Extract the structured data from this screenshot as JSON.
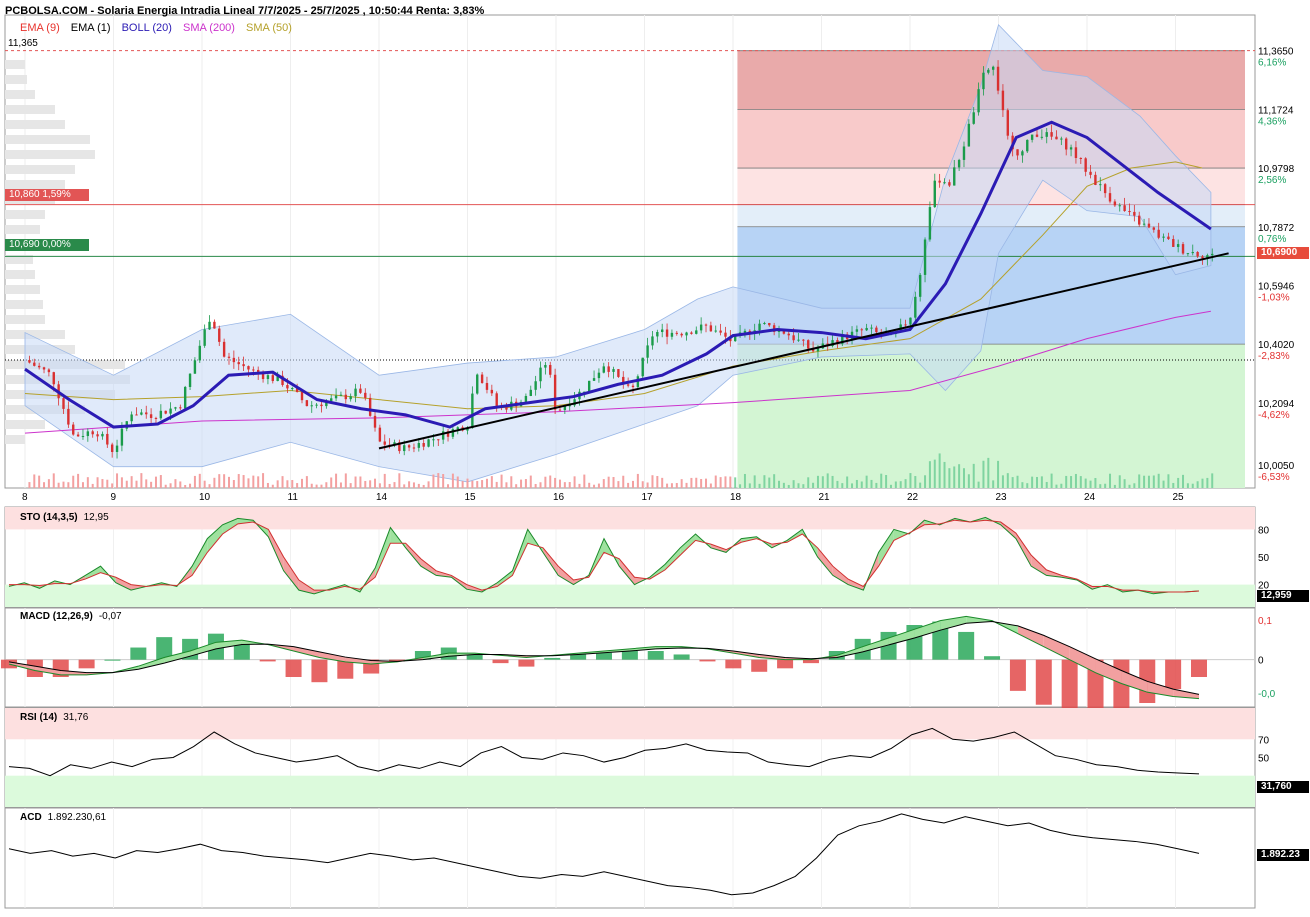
{
  "header": {
    "title": "PCBOLSA.COM - Solaria Energia Intradia Lineal 7/7/2025 - 25/7/2025 , 10:50:44 Renta: 3,83%"
  },
  "legend": [
    {
      "label": "EMA (9)",
      "color": "#e8322c"
    },
    {
      "label": "EMA (1)",
      "color": "#000000"
    },
    {
      "label": "BOLL (20)",
      "color": "#2b1bb4"
    },
    {
      "label": "SMA (200)",
      "color": "#cc33cc"
    },
    {
      "label": "SMA (50)",
      "color": "#b5a12b"
    }
  ],
  "price_panel": {
    "top_value_label": "11,365",
    "tags": [
      {
        "text": "10,860  1,59%",
        "color": "#e25555"
      },
      {
        "text": "10,690  0,00%",
        "color": "#2a8a4a"
      }
    ],
    "last_price_tag": "10,6900"
  },
  "panels": {
    "sto": {
      "title": "STO (14,3,5)",
      "value": "12,95",
      "last_tag": "12,959"
    },
    "macd": {
      "title": "MACD (12,26,9)",
      "value": "-0,07"
    },
    "rsi": {
      "title": "RSI (14)",
      "value": "31,76",
      "last_tag": "31,760"
    },
    "acd": {
      "title": "ACD",
      "value": "1.892.230,61",
      "last_tag": "1.892.23"
    }
  },
  "chart_data": [
    {
      "type": "candlestick",
      "title": "Solaria Energia Intradia Lineal 7/7/2025 - 25/7/2025",
      "x_tick_labels": [
        "8",
        "9",
        "10",
        "11",
        "14",
        "15",
        "16",
        "17",
        "18",
        "21",
        "22",
        "23",
        "24",
        "25"
      ],
      "y_tick_labels": [
        "11,3650",
        "11,1724",
        "10,9798",
        "10,7872",
        "10,5946",
        "10,4020",
        "10,2094",
        "10,0050"
      ],
      "pct_tick_labels": [
        "6,16%",
        "4,36%",
        "2,56%",
        "0,76%",
        "-1,03%",
        "-2,83%",
        "-4,62%",
        "-6,53%"
      ],
      "ylim": [
        9.93,
        11.4
      ],
      "close_series": [
        {
          "x": 0,
          "y": 10.35
        },
        {
          "x": 0.3,
          "y": 10.3
        },
        {
          "x": 0.55,
          "y": 10.1
        },
        {
          "x": 0.8,
          "y": 10.12
        },
        {
          "x": 1.0,
          "y": 10.05
        },
        {
          "x": 1.2,
          "y": 10.18
        },
        {
          "x": 1.45,
          "y": 10.17
        },
        {
          "x": 1.75,
          "y": 10.2
        },
        {
          "x": 2.0,
          "y": 10.42
        },
        {
          "x": 2.1,
          "y": 10.5
        },
        {
          "x": 2.25,
          "y": 10.36
        },
        {
          "x": 2.6,
          "y": 10.31
        },
        {
          "x": 2.9,
          "y": 10.28
        },
        {
          "x": 3.2,
          "y": 10.2
        },
        {
          "x": 3.5,
          "y": 10.22
        },
        {
          "x": 3.8,
          "y": 10.25
        },
        {
          "x": 4.0,
          "y": 10.08
        },
        {
          "x": 4.3,
          "y": 10.06
        },
        {
          "x": 4.6,
          "y": 10.09
        },
        {
          "x": 5.0,
          "y": 10.14
        },
        {
          "x": 5.1,
          "y": 10.32
        },
        {
          "x": 5.35,
          "y": 10.19
        },
        {
          "x": 5.65,
          "y": 10.22
        },
        {
          "x": 5.9,
          "y": 10.35
        },
        {
          "x": 6.0,
          "y": 10.18
        },
        {
          "x": 6.3,
          "y": 10.25
        },
        {
          "x": 6.55,
          "y": 10.34
        },
        {
          "x": 6.85,
          "y": 10.24
        },
        {
          "x": 7.1,
          "y": 10.44
        },
        {
          "x": 7.4,
          "y": 10.44
        },
        {
          "x": 7.7,
          "y": 10.46
        },
        {
          "x": 8.0,
          "y": 10.41
        },
        {
          "x": 8.3,
          "y": 10.47
        },
        {
          "x": 8.6,
          "y": 10.44
        },
        {
          "x": 8.9,
          "y": 10.38
        },
        {
          "x": 9.2,
          "y": 10.42
        },
        {
          "x": 9.5,
          "y": 10.45
        },
        {
          "x": 9.8,
          "y": 10.42
        },
        {
          "x": 10.0,
          "y": 10.49
        },
        {
          "x": 10.1,
          "y": 10.6
        },
        {
          "x": 10.2,
          "y": 10.82
        },
        {
          "x": 10.3,
          "y": 10.95
        },
        {
          "x": 10.45,
          "y": 10.93
        },
        {
          "x": 10.6,
          "y": 11.05
        },
        {
          "x": 10.75,
          "y": 11.2
        },
        {
          "x": 10.85,
          "y": 11.3
        },
        {
          "x": 10.95,
          "y": 11.31
        },
        {
          "x": 11.1,
          "y": 11.08
        },
        {
          "x": 11.25,
          "y": 11.02
        },
        {
          "x": 11.4,
          "y": 11.1
        },
        {
          "x": 11.6,
          "y": 11.08
        },
        {
          "x": 11.8,
          "y": 11.05
        },
        {
          "x": 12.0,
          "y": 10.97
        },
        {
          "x": 12.2,
          "y": 10.9
        },
        {
          "x": 12.45,
          "y": 10.83
        },
        {
          "x": 12.7,
          "y": 10.78
        },
        {
          "x": 12.9,
          "y": 10.74
        },
        {
          "x": 13.1,
          "y": 10.71
        },
        {
          "x": 13.25,
          "y": 10.7
        },
        {
          "x": 13.42,
          "y": 10.69
        }
      ],
      "boll_mid": [
        {
          "x": 0,
          "y": 10.32
        },
        {
          "x": 0.5,
          "y": 10.22
        },
        {
          "x": 1.0,
          "y": 10.13
        },
        {
          "x": 1.5,
          "y": 10.14
        },
        {
          "x": 1.9,
          "y": 10.2
        },
        {
          "x": 2.3,
          "y": 10.3
        },
        {
          "x": 2.8,
          "y": 10.31
        },
        {
          "x": 3.3,
          "y": 10.22
        },
        {
          "x": 3.8,
          "y": 10.19
        },
        {
          "x": 4.3,
          "y": 10.17
        },
        {
          "x": 4.8,
          "y": 10.13
        },
        {
          "x": 5.2,
          "y": 10.19
        },
        {
          "x": 5.7,
          "y": 10.21
        },
        {
          "x": 6.2,
          "y": 10.23
        },
        {
          "x": 6.7,
          "y": 10.27
        },
        {
          "x": 7.2,
          "y": 10.3
        },
        {
          "x": 7.7,
          "y": 10.37
        },
        {
          "x": 8.0,
          "y": 10.43
        },
        {
          "x": 8.5,
          "y": 10.45
        },
        {
          "x": 9.0,
          "y": 10.44
        },
        {
          "x": 9.5,
          "y": 10.42
        },
        {
          "x": 10.0,
          "y": 10.45
        },
        {
          "x": 10.4,
          "y": 10.6
        },
        {
          "x": 10.8,
          "y": 10.83
        },
        {
          "x": 11.2,
          "y": 11.08
        },
        {
          "x": 11.6,
          "y": 11.13
        },
        {
          "x": 12.0,
          "y": 11.08
        },
        {
          "x": 12.4,
          "y": 10.99
        },
        {
          "x": 12.8,
          "y": 10.9
        },
        {
          "x": 13.2,
          "y": 10.82
        },
        {
          "x": 13.4,
          "y": 10.78
        }
      ],
      "sma50": [
        {
          "x": 0,
          "y": 10.24
        },
        {
          "x": 1.0,
          "y": 10.22
        },
        {
          "x": 2.0,
          "y": 10.23
        },
        {
          "x": 3.0,
          "y": 10.25
        },
        {
          "x": 4.0,
          "y": 10.22
        },
        {
          "x": 5.0,
          "y": 10.19
        },
        {
          "x": 6.0,
          "y": 10.2
        },
        {
          "x": 7.0,
          "y": 10.24
        },
        {
          "x": 8.0,
          "y": 10.33
        },
        {
          "x": 9.0,
          "y": 10.38
        },
        {
          "x": 10.0,
          "y": 10.42
        },
        {
          "x": 10.8,
          "y": 10.55
        },
        {
          "x": 11.5,
          "y": 10.76
        },
        {
          "x": 12.0,
          "y": 10.92
        },
        {
          "x": 12.5,
          "y": 10.98
        },
        {
          "x": 13.0,
          "y": 11.0
        },
        {
          "x": 13.3,
          "y": 10.98
        }
      ],
      "sma200": [
        {
          "x": 0,
          "y": 10.11
        },
        {
          "x": 2.0,
          "y": 10.15
        },
        {
          "x": 4.0,
          "y": 10.16
        },
        {
          "x": 6.0,
          "y": 10.18
        },
        {
          "x": 8.0,
          "y": 10.21
        },
        {
          "x": 10.0,
          "y": 10.25
        },
        {
          "x": 11.0,
          "y": 10.33
        },
        {
          "x": 12.0,
          "y": 10.42
        },
        {
          "x": 13.0,
          "y": 10.49
        },
        {
          "x": 13.4,
          "y": 10.51
        }
      ],
      "boll_upper": [
        {
          "x": 0,
          "y": 10.44
        },
        {
          "x": 1.0,
          "y": 10.3
        },
        {
          "x": 2.0,
          "y": 10.45
        },
        {
          "x": 3.0,
          "y": 10.5
        },
        {
          "x": 4.0,
          "y": 10.3
        },
        {
          "x": 5.0,
          "y": 10.34
        },
        {
          "x": 6.0,
          "y": 10.36
        },
        {
          "x": 7.0,
          "y": 10.45
        },
        {
          "x": 7.6,
          "y": 10.55
        },
        {
          "x": 8.0,
          "y": 10.59
        },
        {
          "x": 9.0,
          "y": 10.52
        },
        {
          "x": 10.0,
          "y": 10.52
        },
        {
          "x": 10.4,
          "y": 10.95
        },
        {
          "x": 10.8,
          "y": 11.25
        },
        {
          "x": 11.0,
          "y": 11.45
        },
        {
          "x": 11.5,
          "y": 11.3
        },
        {
          "x": 12.0,
          "y": 11.28
        },
        {
          "x": 12.6,
          "y": 11.15
        },
        {
          "x": 13.0,
          "y": 11.02
        },
        {
          "x": 13.4,
          "y": 10.9
        }
      ],
      "boll_lower": [
        {
          "x": 0,
          "y": 10.2
        },
        {
          "x": 1.0,
          "y": 10.0
        },
        {
          "x": 2.0,
          "y": 10.0
        },
        {
          "x": 3.0,
          "y": 10.08
        },
        {
          "x": 4.0,
          "y": 10.0
        },
        {
          "x": 5.0,
          "y": 9.95
        },
        {
          "x": 6.0,
          "y": 10.04
        },
        {
          "x": 7.0,
          "y": 10.14
        },
        {
          "x": 7.6,
          "y": 10.2
        },
        {
          "x": 8.0,
          "y": 10.3
        },
        {
          "x": 9.0,
          "y": 10.36
        },
        {
          "x": 10.0,
          "y": 10.37
        },
        {
          "x": 10.4,
          "y": 10.25
        },
        {
          "x": 10.8,
          "y": 10.38
        },
        {
          "x": 11.0,
          "y": 10.7
        },
        {
          "x": 11.5,
          "y": 10.94
        },
        {
          "x": 12.0,
          "y": 10.84
        },
        {
          "x": 12.6,
          "y": 10.82
        },
        {
          "x": 13.0,
          "y": 10.63
        },
        {
          "x": 13.4,
          "y": 10.66
        }
      ],
      "trendline": [
        {
          "x": 4.0,
          "y": 10.06
        },
        {
          "x": 13.6,
          "y": 10.7
        }
      ],
      "fib_levels": [
        11.365,
        11.1724,
        10.9798,
        10.86,
        10.7872,
        10.69,
        10.402
      ],
      "reference_lines": [
        {
          "name": "max",
          "y": 11.365
        },
        {
          "name": "stop",
          "y": 10.86
        },
        {
          "name": "base",
          "y": 10.69
        }
      ]
    },
    {
      "type": "line",
      "title": "STO (14,3,5)",
      "y_tick_labels": [
        "80",
        "50",
        "20"
      ],
      "ylim": [
        0,
        100
      ],
      "zones": [
        20,
        80
      ],
      "series": [
        {
          "name": "%K",
          "values": [
            18,
            22,
            16,
            24,
            20,
            30,
            40,
            22,
            14,
            18,
            22,
            18,
            40,
            70,
            85,
            92,
            90,
            72,
            35,
            14,
            10,
            15,
            20,
            12,
            38,
            82,
            60,
            40,
            30,
            28,
            15,
            12,
            22,
            35,
            80,
            55,
            30,
            20,
            30,
            70,
            40,
            20,
            28,
            42,
            60,
            75,
            60,
            55,
            70,
            72,
            60,
            68,
            80,
            50,
            30,
            20,
            14,
            55,
            80,
            75,
            90,
            85,
            92,
            88,
            93,
            85,
            70,
            40,
            30,
            28,
            25,
            15,
            20,
            12,
            14,
            10,
            12,
            12,
            13
          ]
        },
        {
          "name": "%D",
          "values": [
            20,
            20,
            19,
            21,
            21,
            26,
            33,
            28,
            20,
            18,
            20,
            19,
            30,
            55,
            75,
            86,
            88,
            80,
            50,
            25,
            14,
            14,
            18,
            15,
            28,
            65,
            65,
            48,
            35,
            30,
            20,
            14,
            18,
            30,
            65,
            60,
            40,
            25,
            28,
            55,
            48,
            28,
            26,
            36,
            52,
            68,
            64,
            58,
            66,
            70,
            64,
            66,
            75,
            60,
            40,
            26,
            18,
            40,
            68,
            76,
            85,
            86,
            90,
            88,
            90,
            88,
            76,
            52,
            36,
            30,
            26,
            18,
            18,
            14,
            14,
            12,
            12,
            12,
            13
          ]
        }
      ]
    },
    {
      "type": "line",
      "title": "MACD (12,26,9)",
      "y_tick_labels": [
        "0,1",
        "0",
        "-0,0"
      ],
      "ylim": [
        -0.1,
        0.11
      ],
      "series": [
        {
          "name": "MACD",
          "values": [
            -0.01,
            -0.025,
            -0.035,
            -0.035,
            -0.03,
            -0.015,
            0.005,
            0.02,
            0.04,
            0.045,
            0.035,
            0.02,
            0.005,
            -0.005,
            -0.01,
            -0.005,
            0.005,
            0.015,
            0.015,
            0.01,
            0.005,
            0.01,
            0.015,
            0.02,
            0.025,
            0.03,
            0.03,
            0.025,
            0.015,
            0.005,
            0.0,
            0.0,
            0.01,
            0.03,
            0.05,
            0.07,
            0.09,
            0.1,
            0.09,
            0.06,
            0.03,
            0.0,
            -0.03,
            -0.055,
            -0.075,
            -0.085,
            -0.09
          ]
        },
        {
          "name": "Signal",
          "values": [
            -0.005,
            -0.015,
            -0.025,
            -0.03,
            -0.03,
            -0.022,
            -0.008,
            0.008,
            0.025,
            0.035,
            0.036,
            0.03,
            0.018,
            0.006,
            -0.002,
            -0.004,
            0.0,
            0.008,
            0.012,
            0.012,
            0.009,
            0.009,
            0.012,
            0.016,
            0.02,
            0.025,
            0.027,
            0.026,
            0.02,
            0.012,
            0.005,
            0.002,
            0.005,
            0.018,
            0.034,
            0.05,
            0.068,
            0.084,
            0.088,
            0.078,
            0.056,
            0.03,
            0.002,
            -0.025,
            -0.05,
            -0.068,
            -0.08
          ]
        }
      ]
    },
    {
      "type": "line",
      "title": "RSI (14)",
      "y_tick_labels": [
        "70",
        "50"
      ],
      "ylim": [
        0,
        100
      ],
      "zones": [
        30,
        70
      ],
      "series": [
        {
          "name": "RSI",
          "values": [
            40,
            38,
            30,
            42,
            38,
            45,
            40,
            48,
            50,
            62,
            78,
            65,
            55,
            50,
            45,
            48,
            52,
            40,
            35,
            42,
            38,
            45,
            40,
            55,
            62,
            50,
            48,
            55,
            52,
            45,
            50,
            58,
            60,
            65,
            58,
            56,
            55,
            45,
            42,
            40,
            48,
            52,
            50,
            60,
            75,
            82,
            70,
            68,
            72,
            78,
            65,
            52,
            48,
            42,
            40,
            36,
            34,
            33,
            32
          ]
        }
      ]
    },
    {
      "type": "line",
      "title": "ACD",
      "ylim": [
        0,
        100
      ],
      "series": [
        {
          "name": "ACD",
          "values": [
            60,
            55,
            58,
            52,
            55,
            50,
            58,
            56,
            60,
            65,
            58,
            56,
            52,
            50,
            48,
            45,
            50,
            55,
            52,
            48,
            50,
            45,
            40,
            35,
            30,
            28,
            32,
            30,
            35,
            30,
            25,
            20,
            18,
            15,
            10,
            12,
            20,
            30,
            50,
            75,
            85,
            90,
            98,
            92,
            88,
            95,
            90,
            85,
            88,
            80,
            75,
            72,
            70,
            68,
            65,
            60,
            55
          ]
        }
      ]
    }
  ]
}
